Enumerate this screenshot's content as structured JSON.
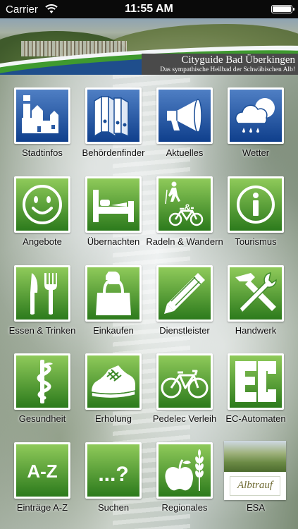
{
  "status_bar": {
    "carrier": "Carrier",
    "time": "11:55 AM"
  },
  "header": {
    "title": "Cityguide Bad Überkingen",
    "subtitle": "Das sympathische Heilbad der Schwäbischen Alb!"
  },
  "colors": {
    "tile_green_dark": "#2e7d1f",
    "tile_green_light": "#7fc04c",
    "header_green": "#3f9a2f",
    "header_blue": "#1f4e8c"
  },
  "tiles": [
    {
      "label": "Stadtinfos",
      "icon": "city-info-icon",
      "color": "blue"
    },
    {
      "label": "Behördenfinder",
      "icon": "binders-icon",
      "color": "blue"
    },
    {
      "label": "Aktuelles",
      "icon": "megaphone-icon",
      "color": "blue"
    },
    {
      "label": "Wetter",
      "icon": "weather-icon",
      "color": "blue"
    },
    {
      "label": "Angebote",
      "icon": "smiley-icon",
      "color": "green"
    },
    {
      "label": "Übernachten",
      "icon": "bed-icon",
      "color": "green"
    },
    {
      "label": "Radeln & Wandern",
      "icon": "hiker-bike-icon",
      "color": "green",
      "glyph": "&"
    },
    {
      "label": "Tourismus",
      "icon": "info-icon",
      "color": "green"
    },
    {
      "label": "Essen & Trinken",
      "icon": "knife-fork-icon",
      "color": "green"
    },
    {
      "label": "Einkaufen",
      "icon": "shopping-bag-icon",
      "color": "green"
    },
    {
      "label": "Dienstleister",
      "icon": "pencil-icon",
      "color": "green"
    },
    {
      "label": "Handwerk",
      "icon": "hammer-wrench-icon",
      "color": "green"
    },
    {
      "label": "Gesundheit",
      "icon": "caduceus-icon",
      "color": "green"
    },
    {
      "label": "Erholung",
      "icon": "running-shoe-icon",
      "color": "green"
    },
    {
      "label": "Pedelec Verleih",
      "icon": "bicycle-icon",
      "color": "green"
    },
    {
      "label": "EC-Automaten",
      "icon": "ec-logo-icon",
      "color": "green"
    },
    {
      "label": "Einträge A-Z",
      "icon": "a-z-icon",
      "color": "green",
      "glyph": "A-Z"
    },
    {
      "label": "Suchen",
      "icon": "search-question-icon",
      "color": "green",
      "glyph": "...?"
    },
    {
      "label": "Regionales",
      "icon": "apple-wheat-icon",
      "color": "green"
    },
    {
      "label": "ESA",
      "icon": "albtrauf-logo-icon",
      "color": "photo",
      "logo_text": "Albtrauf"
    }
  ]
}
